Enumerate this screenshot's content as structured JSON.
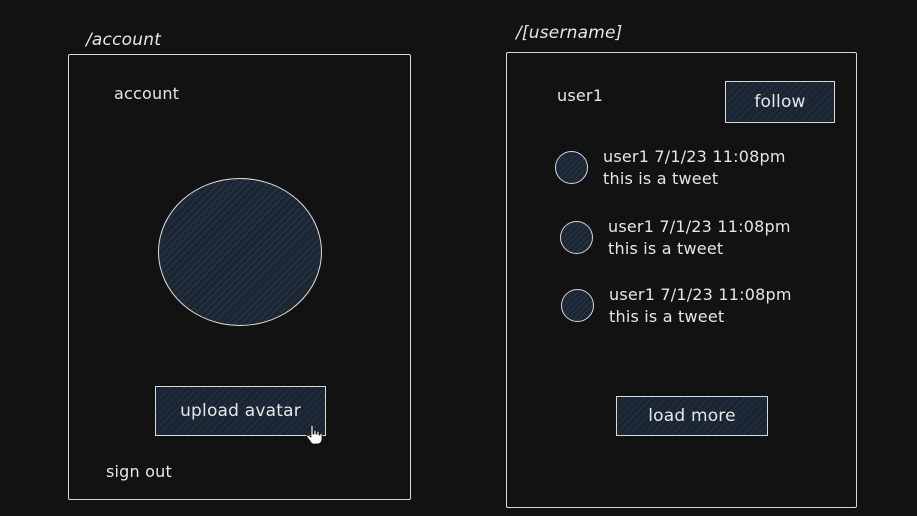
{
  "account_screen": {
    "route": "/account",
    "title": "account",
    "upload_button": "upload avatar",
    "sign_out": "sign out"
  },
  "profile_screen": {
    "route": "/[username]",
    "username": "user1",
    "follow_button": "follow",
    "tweets": [
      {
        "meta": "user1 7/1/23 11:08pm",
        "body": "this is a tweet"
      },
      {
        "meta": "user1 7/1/23 11:08pm",
        "body": "this is a tweet"
      },
      {
        "meta": "user1 7/1/23 11:08pm",
        "body": "this is a tweet"
      }
    ],
    "load_more_button": "load more"
  },
  "icons": {
    "cursor": "hand-pointer-icon",
    "avatar": "avatar-circle"
  },
  "colors": {
    "background": "#121212",
    "stroke": "#d9d9d9",
    "fill": "#1b2635"
  }
}
